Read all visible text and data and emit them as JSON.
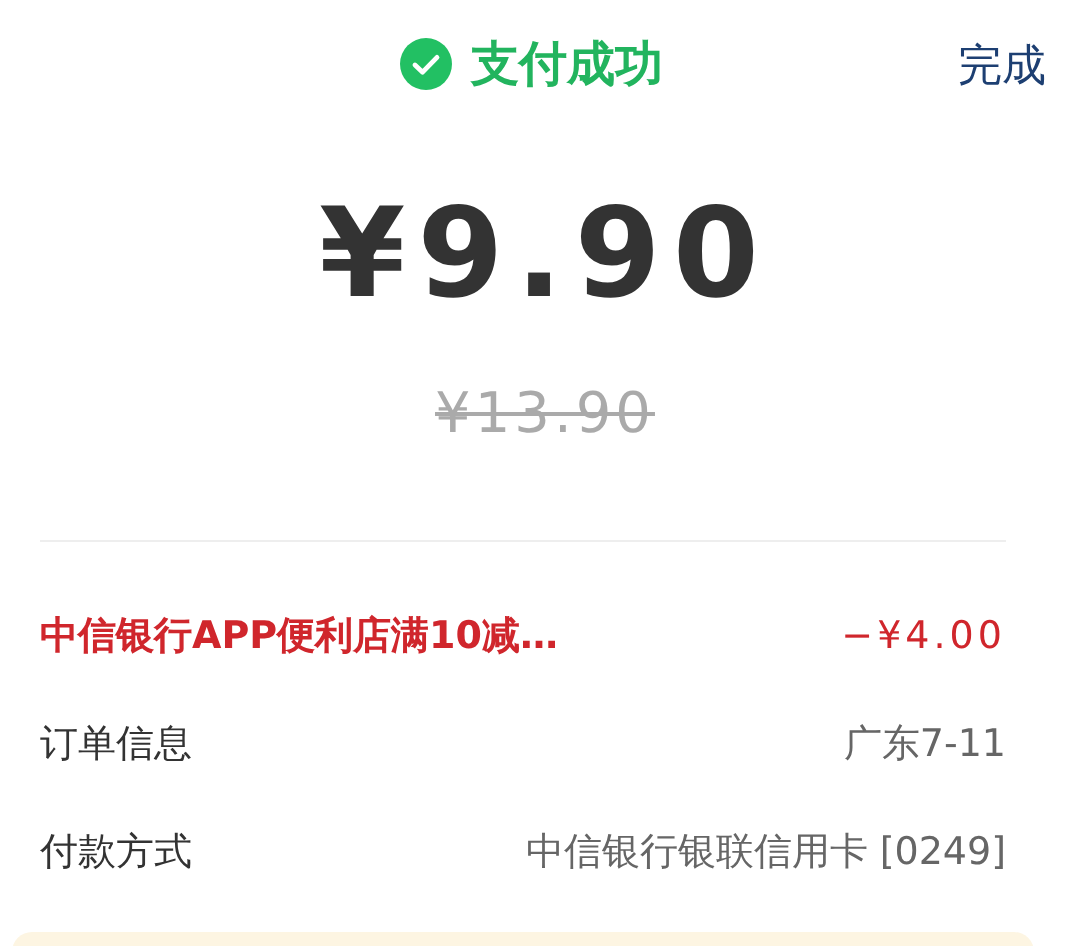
{
  "header": {
    "title": "支付成功",
    "done": "完成"
  },
  "amount": {
    "paid": "¥9.90",
    "original": "¥13.90"
  },
  "rows": [
    {
      "kind": "discount",
      "label": "中信银行APP便利店满10减…",
      "value": "−¥4.00"
    },
    {
      "kind": "info",
      "label": "订单信息",
      "value": "广东7-11"
    },
    {
      "kind": "info",
      "label": "付款方式",
      "value": "中信银行银联信用卡 [0249]"
    }
  ]
}
